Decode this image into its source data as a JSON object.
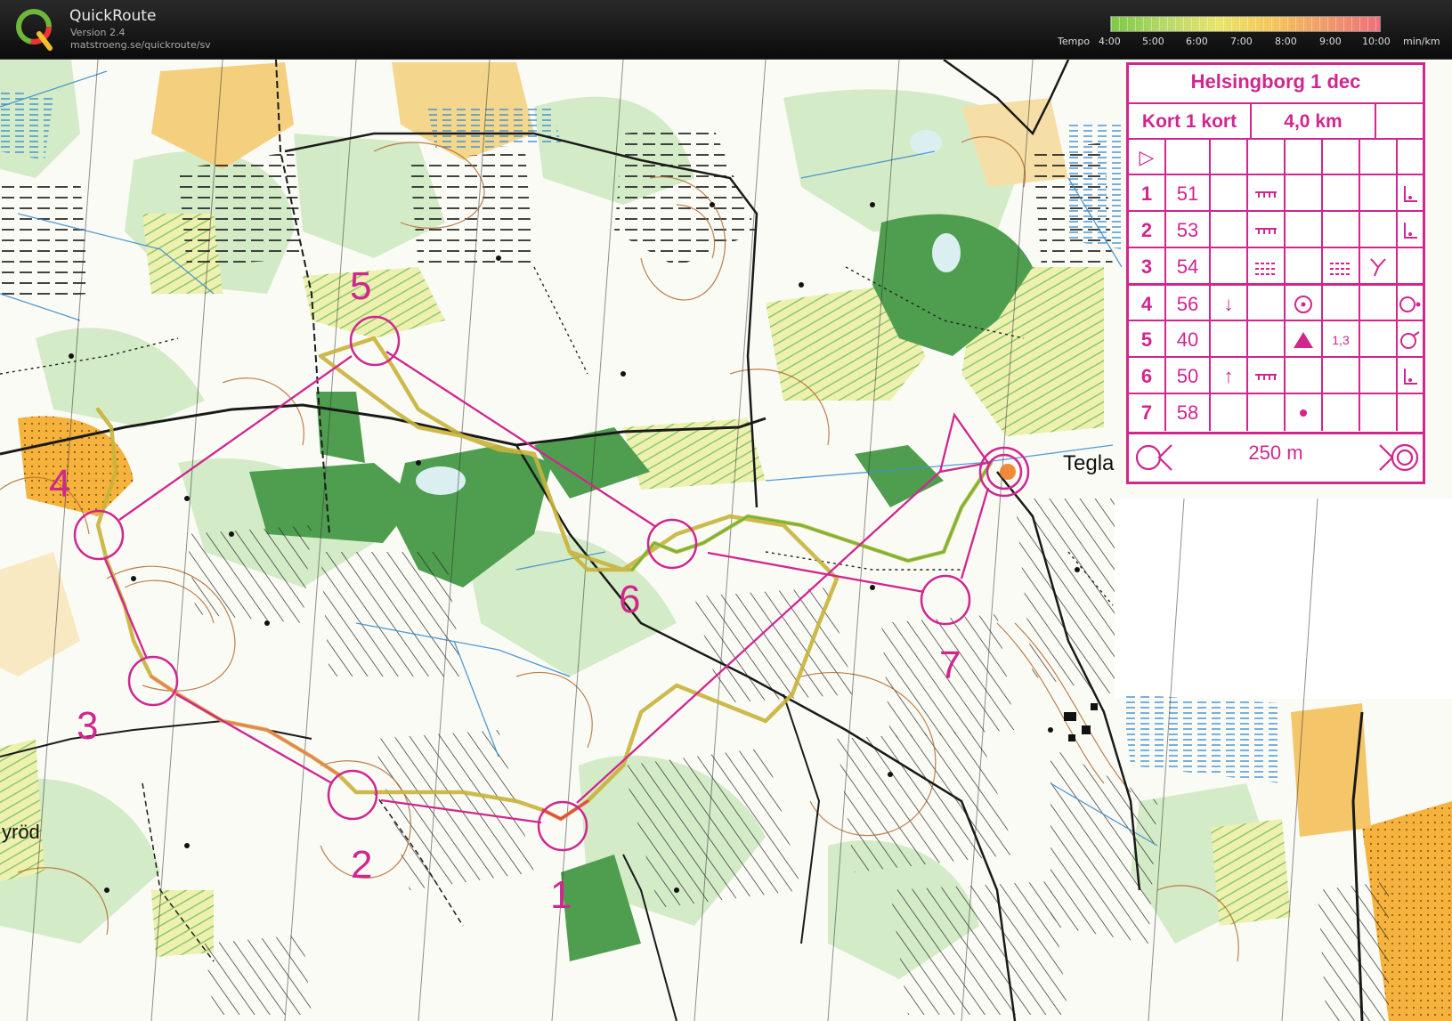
{
  "app": {
    "name": "QuickRoute",
    "version": "Version 2.4",
    "url": "matstroeng.se/quickroute/sv"
  },
  "tempo": {
    "label": "Tempo",
    "unit": "min/km",
    "ticks": [
      "4:00",
      "5:00",
      "6:00",
      "7:00",
      "8:00",
      "9:00",
      "10:00"
    ],
    "gradient": [
      "#7ac943",
      "#b8d96a",
      "#e9e56a",
      "#f4c65a",
      "#f19a6a",
      "#ef6f7a"
    ]
  },
  "control_card": {
    "title": "Helsingborg 1 dec",
    "course": "Kort 1 kort",
    "length": "4,0 km",
    "rows": [
      {
        "num": "1",
        "code": "51",
        "dir": "",
        "feat": "ditch-end",
        "extra": "",
        "where": "bend"
      },
      {
        "num": "2",
        "code": "53",
        "dir": "",
        "feat": "ditch-end",
        "extra": "",
        "where": "bend"
      },
      {
        "num": "3",
        "code": "54",
        "dir": "",
        "feat": "marsh",
        "extra": "marsh",
        "where": "junction"
      },
      {
        "num": "4",
        "code": "56",
        "dir": "↓",
        "feat": "circle-dot",
        "extra": "",
        "where": "dot-right"
      },
      {
        "num": "5",
        "code": "40",
        "dir": "",
        "feat": "triangle",
        "extra": "1,3",
        "where": "circle-right"
      },
      {
        "num": "6",
        "code": "50",
        "dir": "↑",
        "feat": "ditch-end",
        "extra": "",
        "where": "bend"
      },
      {
        "num": "7",
        "code": "58",
        "dir": "",
        "feat": "dot",
        "extra": "",
        "where": ""
      }
    ],
    "finish_distance": "250 m"
  },
  "map": {
    "controls": [
      {
        "label": "1"
      },
      {
        "label": "2"
      },
      {
        "label": "3"
      },
      {
        "label": "4"
      },
      {
        "label": "5"
      },
      {
        "label": "6"
      },
      {
        "label": "7"
      }
    ],
    "place_names": [
      "Tegla",
      "yröd"
    ],
    "colors": {
      "course": "#d0268e",
      "forest": "#4a9b4a",
      "light_green": "#c8e6b8",
      "open": "#f2c46d",
      "contour": "#b36a2e",
      "water": "#3e8fd0"
    }
  }
}
